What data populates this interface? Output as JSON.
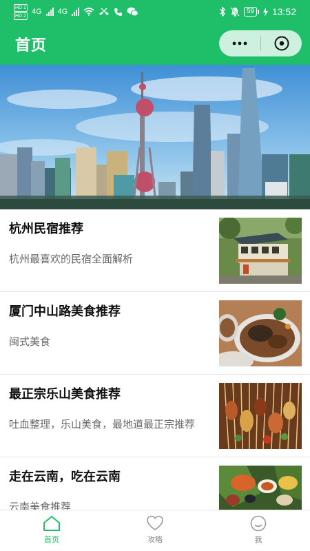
{
  "status_bar": {
    "hd_top": "HD 1",
    "hd_bottom": "HD 2",
    "network1": "4G",
    "network2": "4G",
    "battery": "59",
    "time": "13:52",
    "icons": [
      "signal-icon",
      "wifi-icon",
      "missed-call-icon",
      "phone-icon",
      "wechat-icon",
      "bluetooth-icon",
      "mute-icon",
      "charging-icon"
    ]
  },
  "nav": {
    "title": "首页",
    "more_icon": "more-dots-icon",
    "close_icon": "close-circle-icon"
  },
  "banner": {
    "alt": "shanghai-skyline-image"
  },
  "articles": [
    {
      "title": "杭州民宿推荐",
      "desc": "杭州最喜欢的民宿全面解析",
      "thumb": "guesthouse-image"
    },
    {
      "title": "厦门中山路美食推荐",
      "desc": "闽式美食",
      "thumb": "seafood-dish-image"
    },
    {
      "title": "最正宗乐山美食推荐",
      "desc": "吐血整理，乐山美食，最地道最正宗推荐",
      "thumb": "skewers-image"
    },
    {
      "title": "走在云南，吃在云南",
      "desc": "云南美食推荐",
      "thumb": "yunnan-feast-image"
    }
  ],
  "tabs": [
    {
      "label": "首页",
      "icon": "home-icon",
      "active": true
    },
    {
      "label": "攻略",
      "icon": "heart-icon",
      "active": false
    },
    {
      "label": "我",
      "icon": "smile-icon",
      "active": false
    }
  ],
  "colors": {
    "primary": "#1fbf6a",
    "text_title": "#111111",
    "text_desc": "#666666",
    "tab_inactive": "#888888"
  }
}
